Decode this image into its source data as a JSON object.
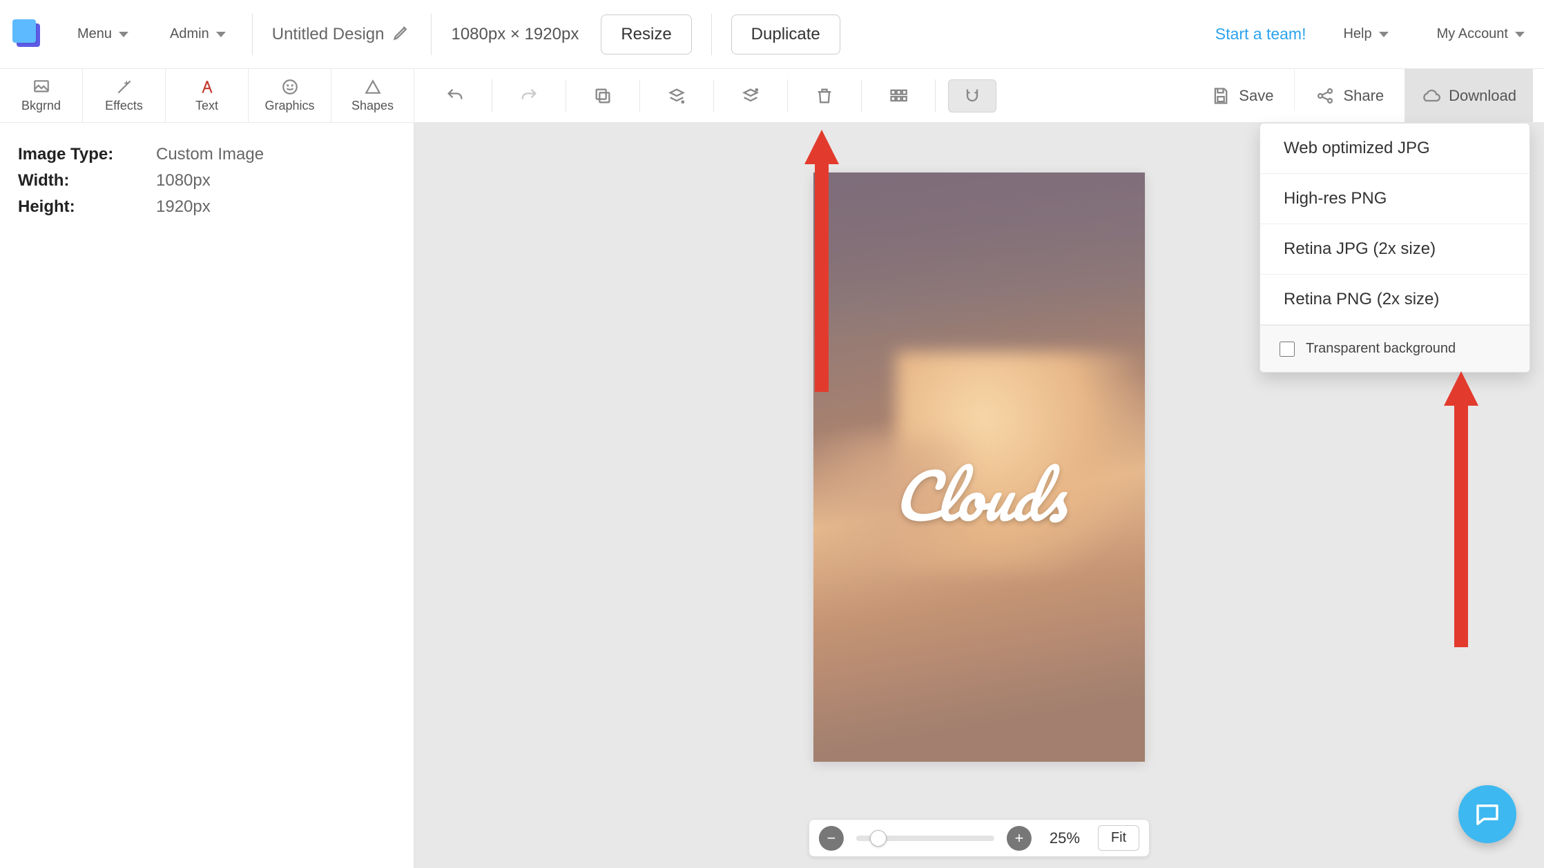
{
  "topbar": {
    "menu_label": "Menu",
    "admin_label": "Admin",
    "design_title": "Untitled Design",
    "dimensions": "1080px × 1920px",
    "resize_label": "Resize",
    "duplicate_label": "Duplicate",
    "team_link": "Start a team!",
    "help_label": "Help",
    "account_label": "My Account"
  },
  "tool_tabs": {
    "bkgrnd": "Bkgrnd",
    "effects": "Effects",
    "text": "Text",
    "graphics": "Graphics",
    "shapes": "Shapes"
  },
  "right_actions": {
    "save": "Save",
    "share": "Share",
    "download": "Download"
  },
  "properties": {
    "image_type_label": "Image Type:",
    "image_type_value": "Custom Image",
    "width_label": "Width:",
    "width_value": "1080px",
    "height_label": "Height:",
    "height_value": "1920px"
  },
  "canvas_text": "Clouds",
  "download_menu": {
    "item1": "Web optimized JPG",
    "item2": "High-res PNG",
    "item3": "Retina JPG (2x size)",
    "item4": "Retina PNG (2x size)",
    "transparent_label": "Transparent background"
  },
  "zoom": {
    "percent": "25%",
    "fit_label": "Fit"
  }
}
